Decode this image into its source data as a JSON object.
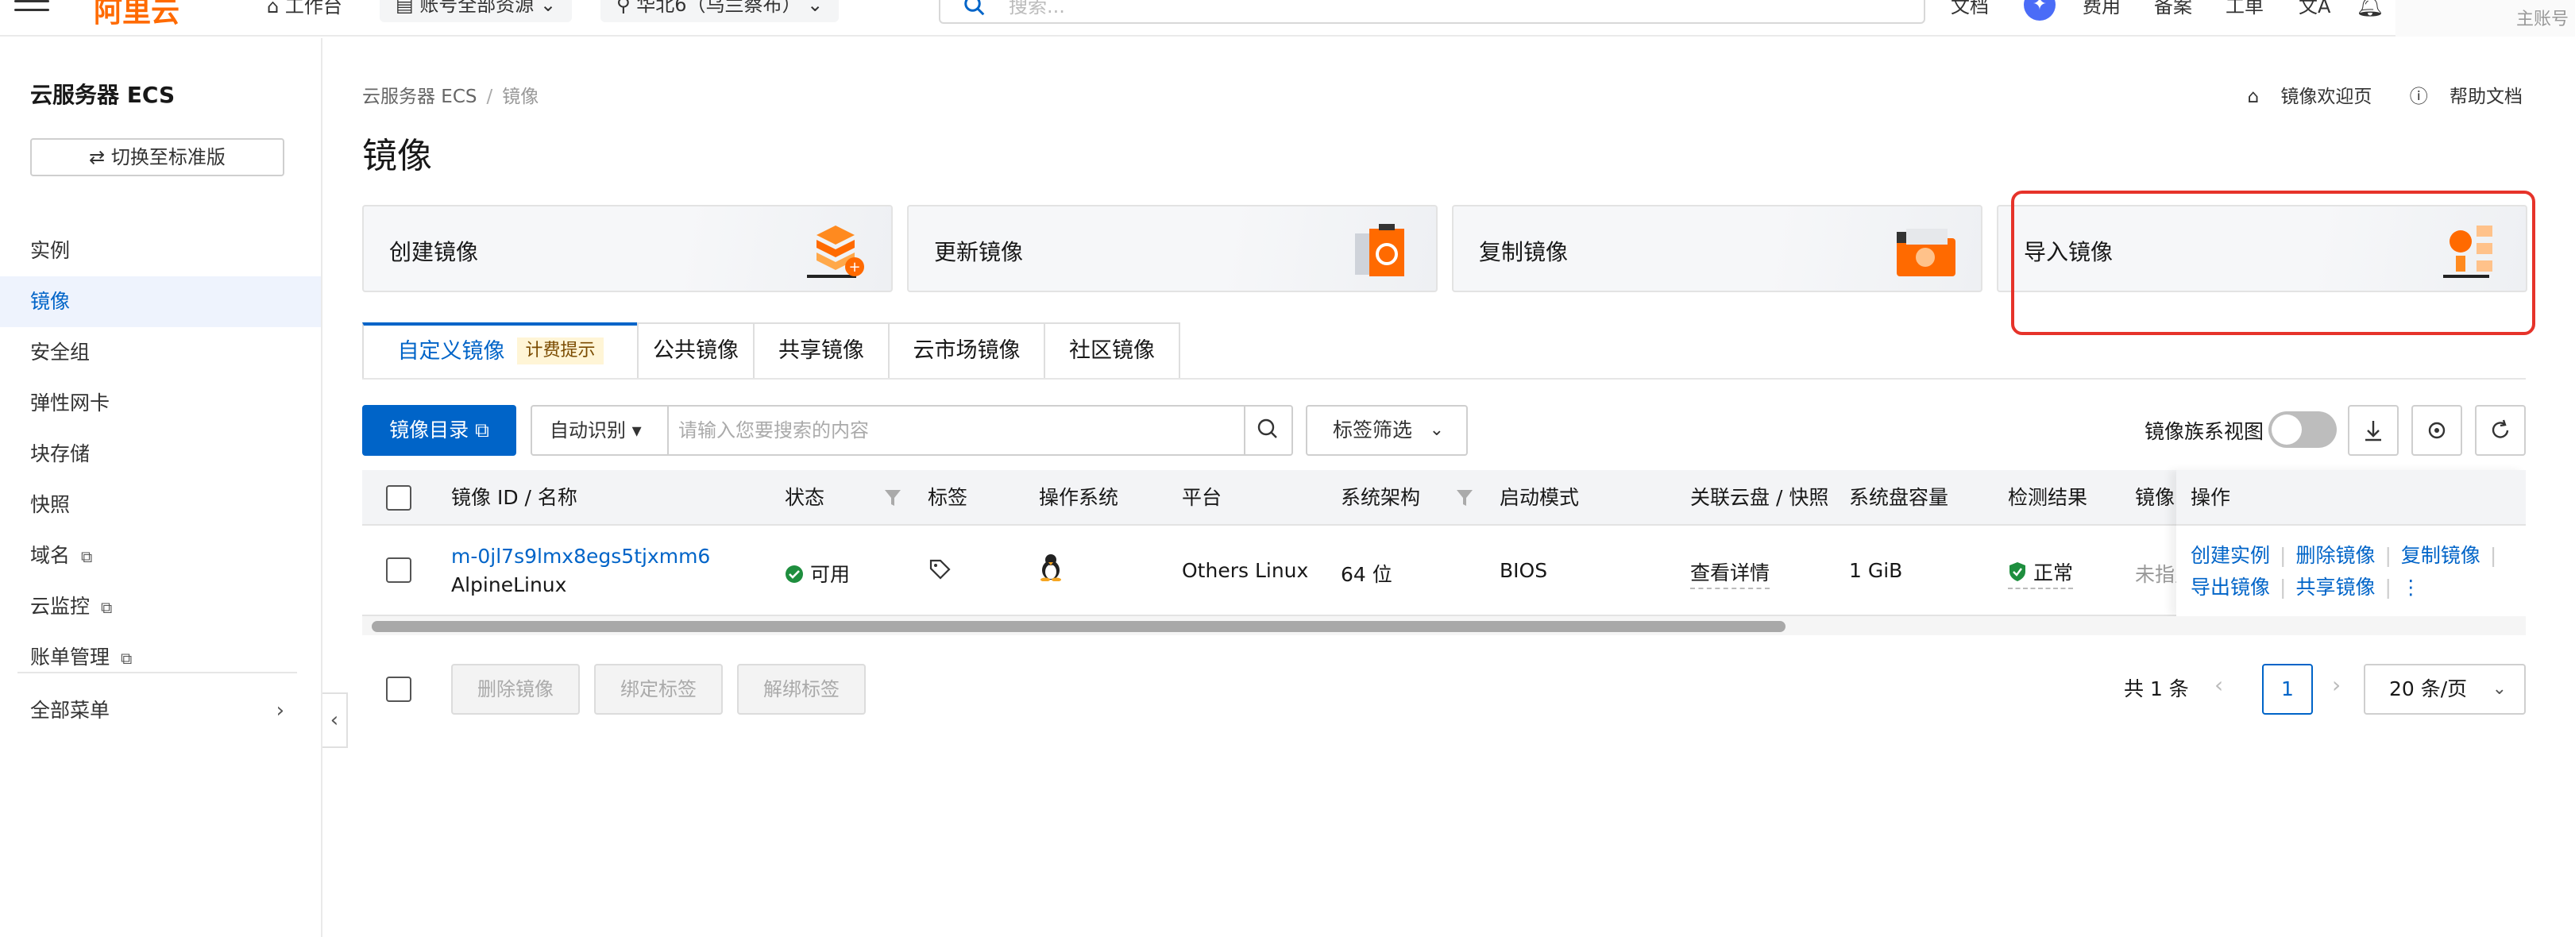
{
  "topnav": {
    "logo": "阿里云",
    "workbench": "工作台",
    "resource_scope": "账号全部资源",
    "region": "华北6（乌兰察布）",
    "search_placeholder": "搜索...",
    "links": [
      "文档",
      "费用",
      "备案",
      "工单"
    ],
    "lang_icon": "文A",
    "account_label": "主账号"
  },
  "sidebar": {
    "title": "云服务器 ECS",
    "switch_label": "切换至标准版",
    "items": [
      {
        "label": "实例"
      },
      {
        "label": "镜像"
      },
      {
        "label": "安全组"
      },
      {
        "label": "弹性网卡"
      },
      {
        "label": "块存储"
      },
      {
        "label": "快照"
      },
      {
        "label": "域名"
      },
      {
        "label": "云监控"
      },
      {
        "label": "账单管理"
      }
    ],
    "all_menu": "全部菜单"
  },
  "breadcrumb": {
    "root": "云服务器 ECS",
    "current": "镜像"
  },
  "top_links": {
    "welcome": "镜像欢迎页",
    "help": "帮助文档"
  },
  "page_title": "镜像",
  "cards": [
    {
      "label": "创建镜像"
    },
    {
      "label": "更新镜像"
    },
    {
      "label": "复制镜像"
    },
    {
      "label": "导入镜像"
    }
  ],
  "tabs": [
    {
      "label": "自定义镜像",
      "badge": "计费提示"
    },
    {
      "label": "公共镜像"
    },
    {
      "label": "共享镜像"
    },
    {
      "label": "云市场镜像"
    },
    {
      "label": "社区镜像"
    }
  ],
  "toolbar": {
    "catalog_button": "镜像目录",
    "search_mode": "自动识别",
    "search_placeholder": "请输入您要搜索的内容",
    "tag_filter": "标签筛选",
    "family_view_label": "镜像族系视图"
  },
  "table": {
    "headers": [
      "镜像 ID / 名称",
      "状态",
      "标签",
      "操作系统",
      "平台",
      "系统架构",
      "启动模式",
      "关联云盘 / 快照",
      "系统盘容量",
      "检测结果",
      "镜像",
      "操作"
    ],
    "rows": [
      {
        "id": "m-0jl7s9lmx8egs5tjxmm6",
        "name": "AlpineLinux",
        "status": "可用",
        "platform": "Others Linux",
        "arch": "64 位",
        "boot": "BIOS",
        "disk_link": "查看详情",
        "capacity": "1 GiB",
        "check": "正常",
        "family": "未指定",
        "actions": [
          "创建实例",
          "删除镜像",
          "复制镜像",
          "导出镜像",
          "共享镜像"
        ],
        "more_icon": "⋮"
      }
    ]
  },
  "bulk_actions": [
    "删除镜像",
    "绑定标签",
    "解绑标签"
  ],
  "pager": {
    "total": "共 1 条",
    "current": "1",
    "page_size": "20 条/页",
    "prev": "‹",
    "next": "›"
  }
}
